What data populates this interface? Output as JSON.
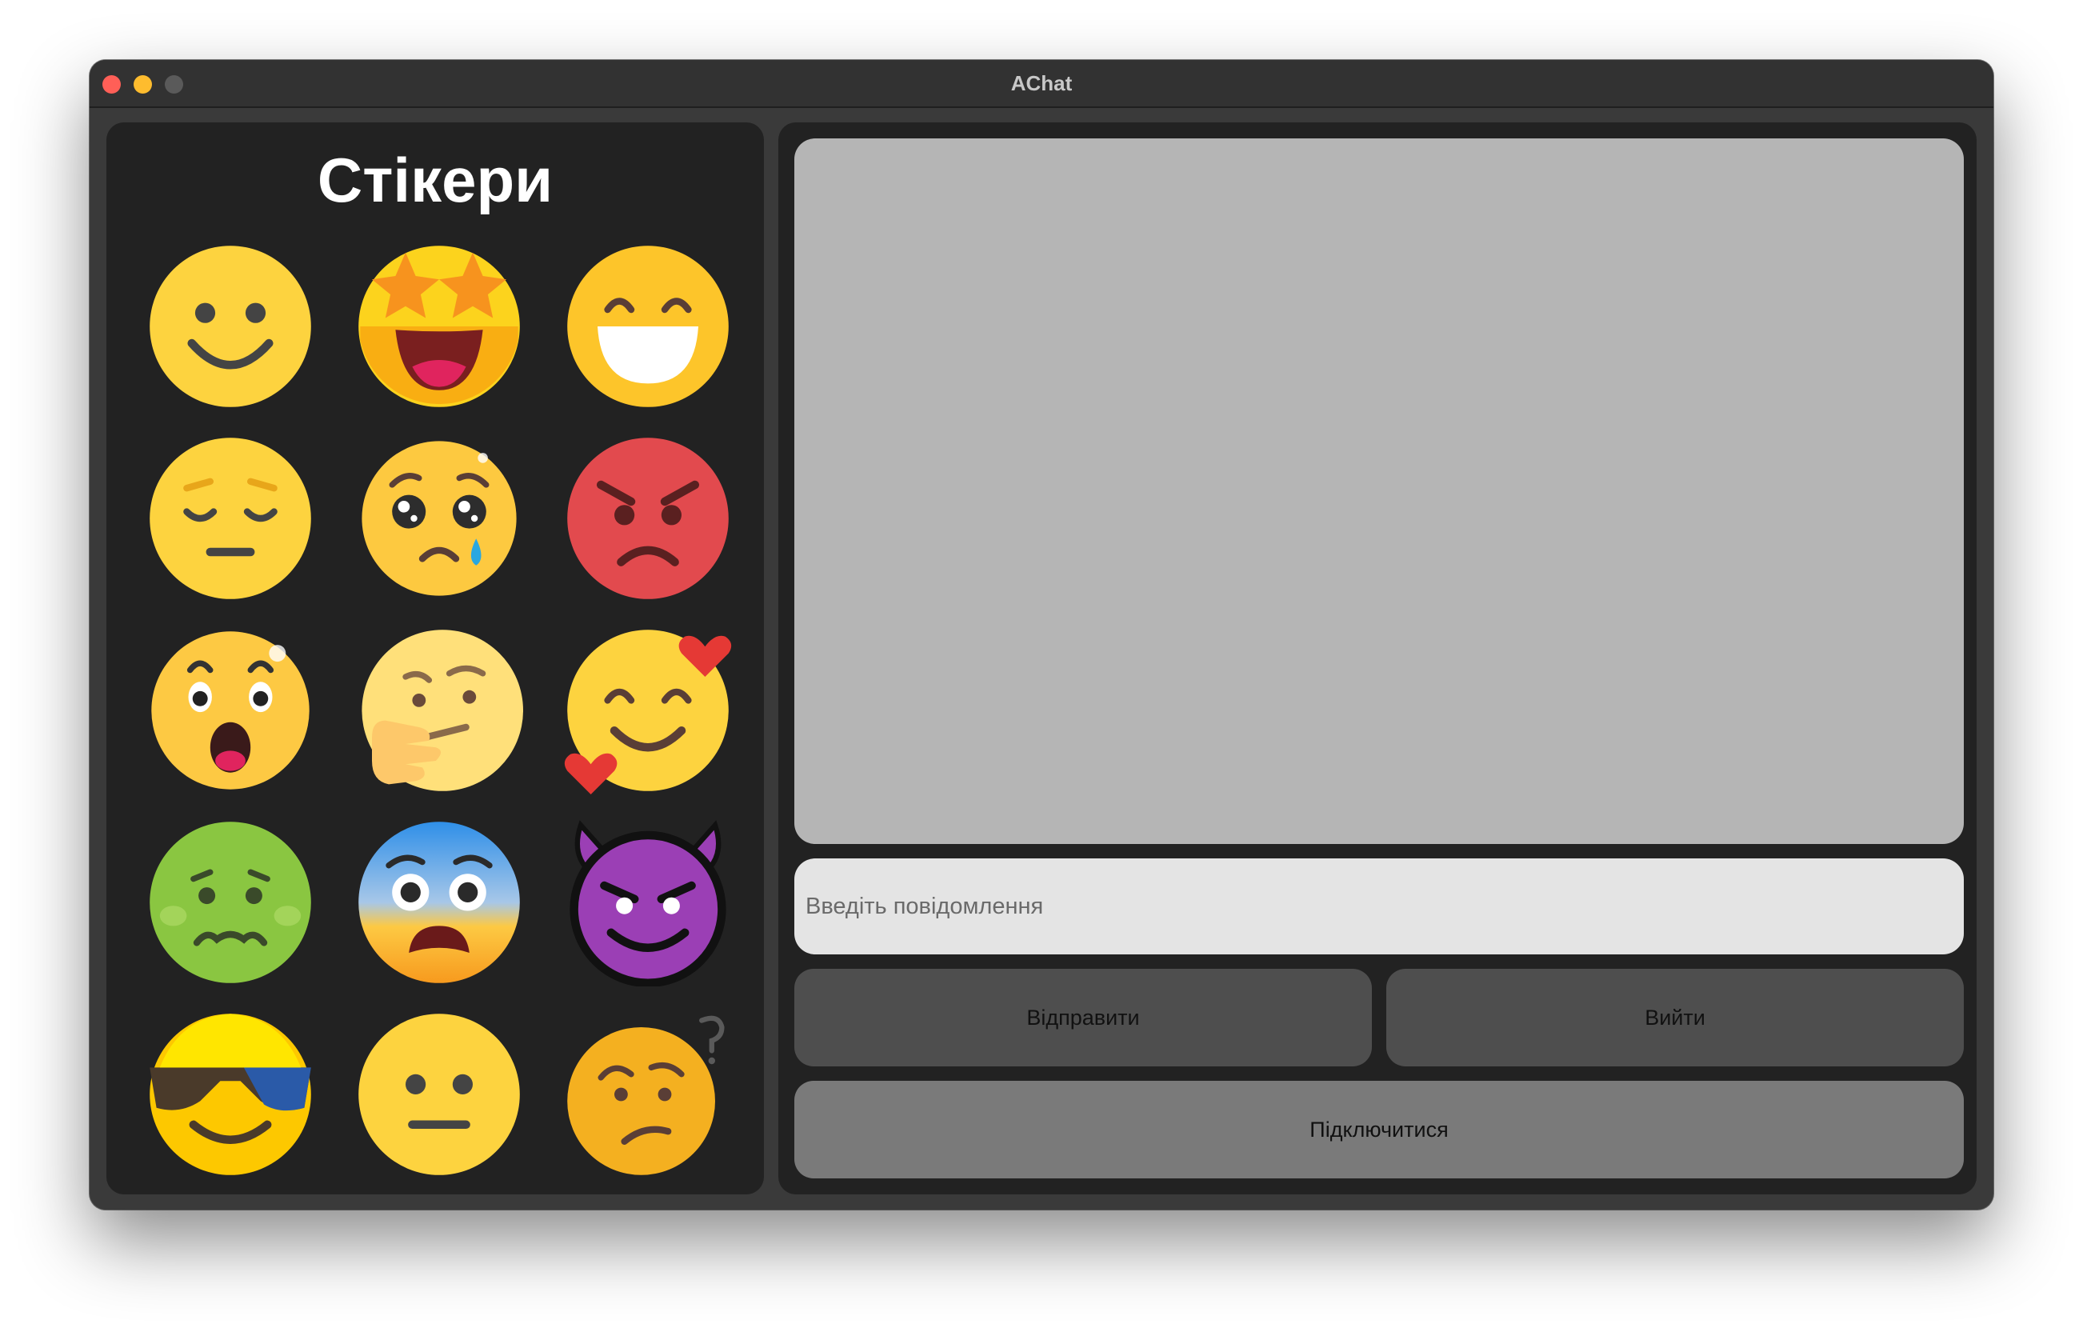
{
  "window": {
    "title": "AChat"
  },
  "stickers_panel": {
    "title": "Стікери",
    "stickers": [
      {
        "name": "smiling-face-icon"
      },
      {
        "name": "star-struck-face-icon"
      },
      {
        "name": "grinning-face-icon"
      },
      {
        "name": "pensive-face-icon"
      },
      {
        "name": "crying-face-icon"
      },
      {
        "name": "angry-face-icon"
      },
      {
        "name": "surprised-face-icon"
      },
      {
        "name": "thinking-face-icon"
      },
      {
        "name": "smiling-face-with-hearts-icon"
      },
      {
        "name": "nauseated-face-icon"
      },
      {
        "name": "fearful-face-icon"
      },
      {
        "name": "devil-face-icon"
      },
      {
        "name": "sunglasses-face-icon"
      },
      {
        "name": "neutral-face-icon"
      },
      {
        "name": "confused-face-icon"
      }
    ]
  },
  "chat": {
    "input_placeholder": "Введіть повідомлення",
    "send_label": "Відправити",
    "exit_label": "Вийти",
    "connect_label": "Підключитися"
  },
  "colors": {
    "window_bg": "#3a3a3a",
    "panel_bg": "#222222",
    "chat_area_bg": "#b5b5b5",
    "input_bg": "#e4e4e4",
    "button_bg": "#4e4e4e",
    "connect_button_bg": "#7a7a7a"
  }
}
